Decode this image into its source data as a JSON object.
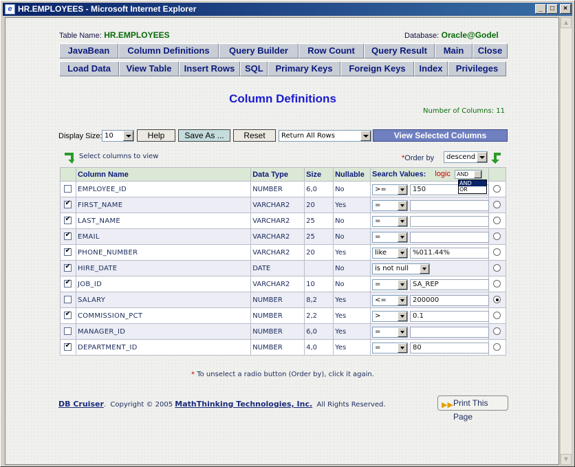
{
  "window": {
    "title": "HR.EMPLOYEES - Microsoft Internet Explorer",
    "controls": {
      "minimize": "_",
      "maximize": "□",
      "close": "×"
    }
  },
  "header": {
    "table_label": "Table Name:",
    "table_value": "HR.EMPLOYEES",
    "database_label": "Database:",
    "database_value": "Oracle@Godel"
  },
  "nav_row1": [
    "JavaBean",
    "Column Definitions",
    "Query Builder",
    "Row Count",
    "Query Result",
    "Main",
    "Close"
  ],
  "nav_row2": [
    "Load Data",
    "View Table",
    "Insert Rows",
    "SQL",
    "Primary Keys",
    "Foreign Keys",
    "Index",
    "Privileges"
  ],
  "page_title": "Column Definitions",
  "column_count_text": "Number of Columns: 11",
  "controls": {
    "display_size_label": "Display Size:",
    "display_size_value": "10",
    "help_label": "Help",
    "save_as_label": "Save As ...",
    "reset_label": "Reset",
    "return_rows_value": "Return All Rows",
    "view_selected_label": "View Selected Columns",
    "select_hint": "Select columns to view",
    "order_by_star": "*",
    "order_by_label": "Order by",
    "order_by_value": "descend"
  },
  "table": {
    "headers": {
      "column_name": "Column Name",
      "data_type": "Data Type",
      "size": "Size",
      "nullable": "Nullable",
      "search_values": "Search Values:",
      "logic_label": "logic",
      "logic_value": "AND"
    },
    "logic_options": [
      "AND",
      "OR"
    ],
    "rows": [
      {
        "checked": false,
        "name": "EMPLOYEE_ID",
        "type": "NUMBER",
        "size": "6,0",
        "nullable": "No",
        "op": ">=",
        "value": "150",
        "order": false
      },
      {
        "checked": true,
        "name": "FIRST_NAME",
        "type": "VARCHAR2",
        "size": "20",
        "nullable": "Yes",
        "op": "=",
        "value": "",
        "order": false
      },
      {
        "checked": true,
        "name": "LAST_NAME",
        "type": "VARCHAR2",
        "size": "25",
        "nullable": "No",
        "op": "=",
        "value": "",
        "order": false
      },
      {
        "checked": true,
        "name": "EMAIL",
        "type": "VARCHAR2",
        "size": "25",
        "nullable": "No",
        "op": "=",
        "value": "",
        "order": false
      },
      {
        "checked": true,
        "name": "PHONE_NUMBER",
        "type": "VARCHAR2",
        "size": "20",
        "nullable": "Yes",
        "op": "like",
        "value": "%011.44%",
        "order": false
      },
      {
        "checked": true,
        "name": "HIRE_DATE",
        "type": "DATE",
        "size": "",
        "nullable": "No",
        "op": "is not null",
        "value": null,
        "order": false
      },
      {
        "checked": true,
        "name": "JOB_ID",
        "type": "VARCHAR2",
        "size": "10",
        "nullable": "No",
        "op": "=",
        "value": "SA_REP",
        "order": false
      },
      {
        "checked": false,
        "name": "SALARY",
        "type": "NUMBER",
        "size": "8,2",
        "nullable": "Yes",
        "op": "<=",
        "value": "200000",
        "order": true
      },
      {
        "checked": true,
        "name": "COMMISSION_PCT",
        "type": "NUMBER",
        "size": "2,2",
        "nullable": "Yes",
        "op": ">",
        "value": "0.1",
        "order": false
      },
      {
        "checked": false,
        "name": "MANAGER_ID",
        "type": "NUMBER",
        "size": "6,0",
        "nullable": "Yes",
        "op": "=",
        "value": "",
        "order": false
      },
      {
        "checked": true,
        "name": "DEPARTMENT_ID",
        "type": "NUMBER",
        "size": "4,0",
        "nullable": "Yes",
        "op": "=",
        "value": "80",
        "order": false
      }
    ]
  },
  "footnote": {
    "star": "*",
    "text": " To unselect a radio button (Order by), click it again."
  },
  "footer": {
    "link1": "DB Cruiser",
    "text1": ".  Copyright © 2005 ",
    "link2": "MathThinking Technologies, Inc.",
    "text2": "  All Rights Reserved.",
    "print_label": "Print This Page"
  },
  "colors": {
    "title_blue": "#1a1ad0",
    "header_green": "#0a6b0a",
    "nav_text": "#0b1a7a",
    "view_selected_bg": "#6f7fc0"
  }
}
